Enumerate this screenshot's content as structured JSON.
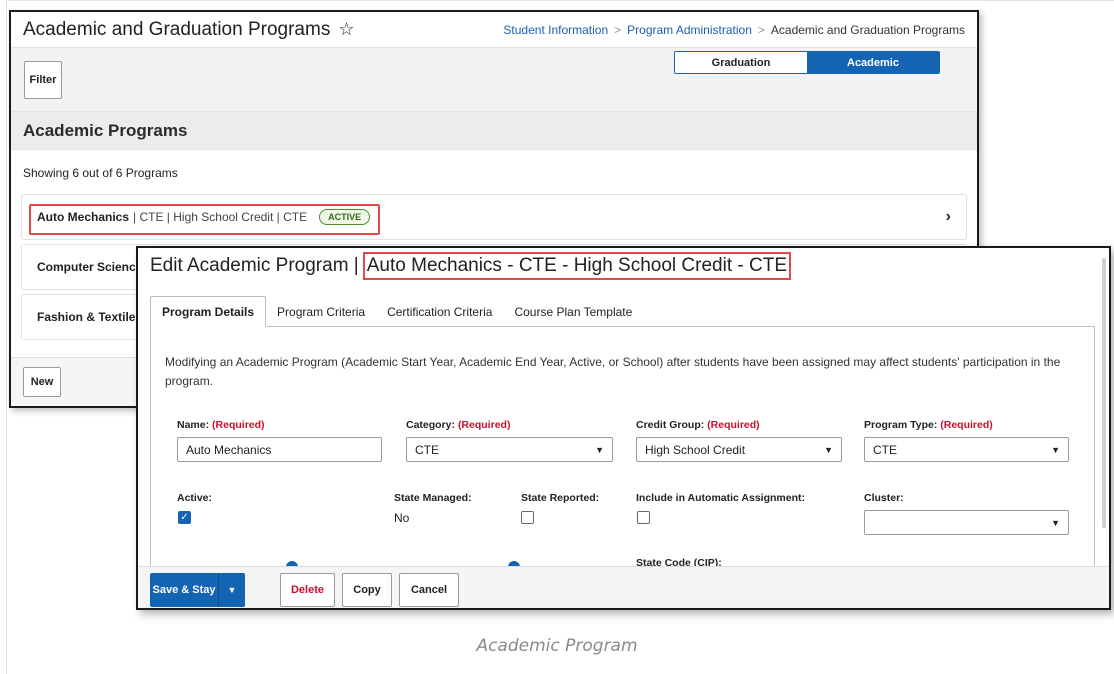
{
  "background_window": {
    "title": "Academic and Graduation Programs",
    "star_icon": "☆",
    "breadcrumbs": [
      "Student Information",
      "Program Administration",
      "Academic and Graduation Programs"
    ],
    "breadcrumb_separator": ">",
    "filter_button": "Filter",
    "toggle": {
      "left": "Graduation",
      "right": "Academic",
      "selected": "Academic"
    },
    "section_title": "Academic Programs",
    "showing_text": "Showing 6 out of 6 Programs",
    "programs": [
      {
        "name": "Auto Mechanics",
        "meta": "| CTE | High School Credit | CTE",
        "badge": "ACTIVE"
      },
      {
        "name": "Computer Scienc"
      },
      {
        "name": "Fashion & Textile"
      }
    ],
    "new_button": "New"
  },
  "modal": {
    "title_prefix": "Edit Academic Program |",
    "title_name": "Auto Mechanics - CTE - High School Credit - CTE",
    "tabs": [
      "Program Details",
      "Program Criteria",
      "Certification Criteria",
      "Course Plan Template"
    ],
    "active_tab": "Program Details",
    "notice": "Modifying an Academic Program (Academic Start Year, Academic End Year, Active, or School) after students have been assigned may affect students' participation in the program.",
    "fields": {
      "name_label": "Name:",
      "name_value": "Auto Mechanics",
      "category_label": "Category:",
      "category_value": "CTE",
      "credit_group_label": "Credit Group:",
      "credit_group_value": "High School Credit",
      "program_type_label": "Program Type:",
      "program_type_value": "CTE",
      "required": "(Required)",
      "active_label": "Active:",
      "state_managed_label": "State Managed:",
      "state_managed_value": "No",
      "state_reported_label": "State Reported:",
      "include_auto_label": "Include in Automatic Assignment:",
      "cluster_label": "Cluster:",
      "cluster_value": "",
      "state_code_label": "State Code (CIP):"
    },
    "footer": {
      "save_stay": "Save & Stay",
      "delete": "Delete",
      "copy": "Copy",
      "cancel": "Cancel"
    }
  },
  "caption": "Academic Program",
  "colors": {
    "accent": "#1464b4",
    "highlight": "#e24a4a",
    "required": "#c8102e",
    "active_badge": "#4d8b31"
  }
}
